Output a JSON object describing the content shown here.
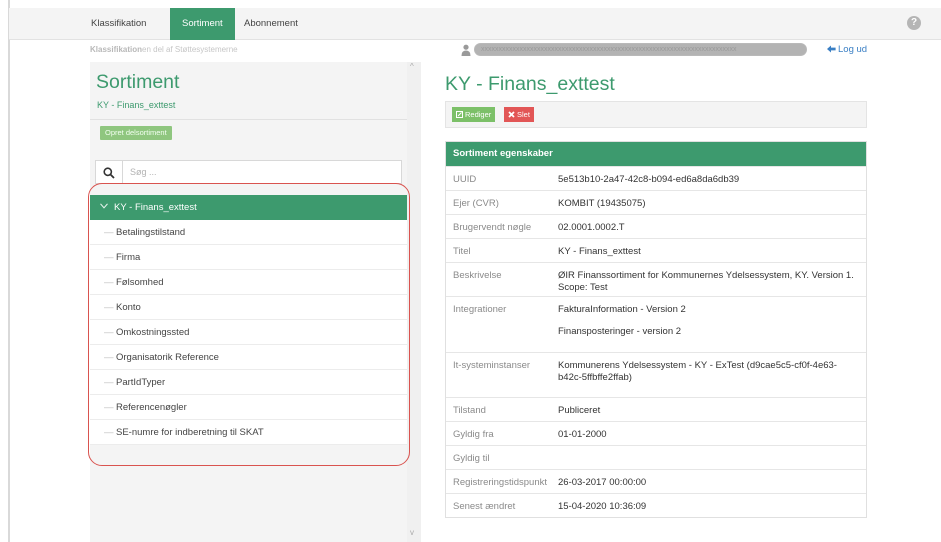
{
  "nav": {
    "tabs": [
      {
        "label": "Klassifikation"
      },
      {
        "label": "Sortiment"
      },
      {
        "label": "Abonnement"
      }
    ]
  },
  "subbar": {
    "crumb_bold": "Klassifikation",
    "crumb_rest": "en del af Støttesystemerne",
    "user_value": "xxxxxxxxxxxxxxxxxxxxxxxxxxxxxxxxxxxxxxxxxxxxxxxxxxxxxxxxxxxxxxxxxxxxxxxxx",
    "logout_label": "Log ud"
  },
  "left": {
    "title": "Sortiment",
    "subtitle": "KY - Finans_exttest",
    "create_button": "Opret delsortiment",
    "search_placeholder": "Søg ...",
    "tree": {
      "root": "KY - Finans_exttest",
      "items": [
        "Betalingstilstand",
        "Firma",
        "Følsomhed",
        "Konto",
        "Omkostningssted",
        "Organisatorik Reference",
        "PartIdTyper",
        "Referencenøgler",
        "SE-numre for indberetning til SKAT"
      ]
    }
  },
  "detail": {
    "title": "KY - Finans_exttest",
    "edit_button": "Rediger",
    "delete_button": "Slet",
    "props_header": "Sortiment egenskaber",
    "rows": [
      {
        "label": "UUID",
        "values": [
          "5e513b10-2a47-42c8-b094-ed6a8da6db39"
        ]
      },
      {
        "label": "Ejer (CVR)",
        "values": [
          "KOMBIT (19435075)"
        ]
      },
      {
        "label": "Brugervendt nøgle",
        "values": [
          "02.0001.0002.T"
        ]
      },
      {
        "label": "Titel",
        "values": [
          "KY - Finans_exttest"
        ]
      },
      {
        "label": "Beskrivelse",
        "values": [
          "ØIR Finanssortiment for Kommunernes Ydelsessystem, KY. Version 1. Scope: Test"
        ]
      },
      {
        "label": "Integrationer",
        "values": [
          "FakturaInformation - Version 2",
          "Finansposteringer - version 2"
        ]
      },
      {
        "label": "It-systeminstanser",
        "values": [
          "Kommunerens Ydelsessystem - KY - ExTest (d9cae5c5-cf0f-4e63-b42c-5ffbffe2ffab)"
        ]
      },
      {
        "label": "Tilstand",
        "values": [
          "Publiceret"
        ]
      },
      {
        "label": "Gyldig fra",
        "values": [
          "01-01-2000"
        ]
      },
      {
        "label": "Gyldig til",
        "values": []
      },
      {
        "label": "Registreringstidspunkt",
        "values": [
          "26-03-2017 00:00:00"
        ]
      },
      {
        "label": "Senest ændret",
        "values": [
          "15-04-2020 10:36:09"
        ]
      }
    ]
  }
}
